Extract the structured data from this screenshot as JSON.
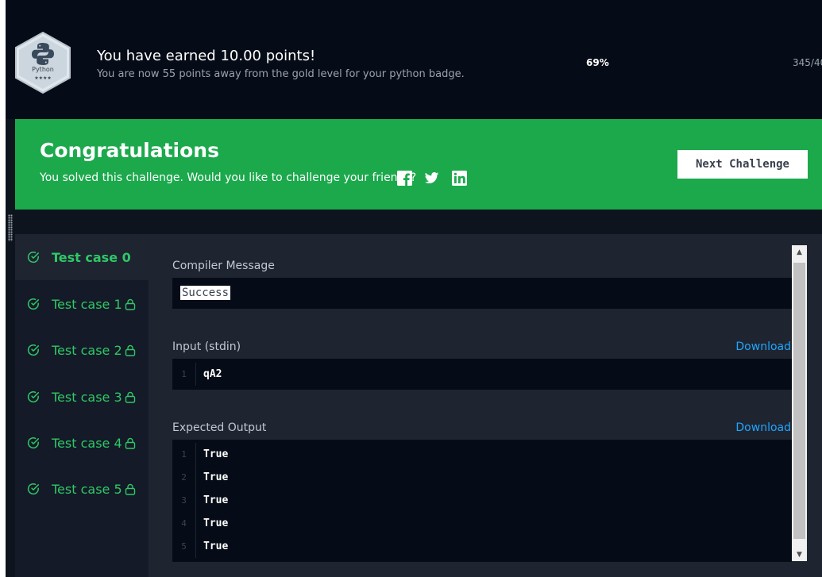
{
  "header": {
    "badge": {
      "name": "Python",
      "stars": "★★★★",
      "icon": "python-logo-icon"
    },
    "earned_text": "You have earned 10.00 points!",
    "away_text": "You are now 55 points away from the gold level for your python badge.",
    "progress_percent": "69%",
    "progress_count": "345/40"
  },
  "banner": {
    "title": "Congratulations",
    "subtitle": "You solved this challenge. Would you like to challenge your friends?",
    "social_icons": [
      "facebook-icon",
      "twitter-icon",
      "linkedin-icon"
    ],
    "next_label": "Next Challenge",
    "color": "#1ba94c"
  },
  "test_cases": [
    {
      "label": "Test case 0",
      "locked": false,
      "active": true
    },
    {
      "label": "Test case 1",
      "locked": true,
      "active": false
    },
    {
      "label": "Test case 2",
      "locked": true,
      "active": false
    },
    {
      "label": "Test case 3",
      "locked": true,
      "active": false
    },
    {
      "label": "Test case 4",
      "locked": true,
      "active": false
    },
    {
      "label": "Test case 5",
      "locked": true,
      "active": false
    }
  ],
  "compiler": {
    "label": "Compiler Message",
    "message": "Success"
  },
  "input": {
    "label": "Input (stdin)",
    "download_label": "Download",
    "lines": [
      {
        "n": "1",
        "text": "qA2"
      }
    ]
  },
  "expected": {
    "label": "Expected Output",
    "download_label": "Download",
    "lines": [
      {
        "n": "1",
        "text": "True"
      },
      {
        "n": "2",
        "text": "True"
      },
      {
        "n": "3",
        "text": "True"
      },
      {
        "n": "4",
        "text": "True"
      },
      {
        "n": "5",
        "text": "True"
      }
    ]
  },
  "colors": {
    "accent_green": "#2ec866",
    "link_blue": "#1ea7fd",
    "page_bg": "#0e141e"
  }
}
